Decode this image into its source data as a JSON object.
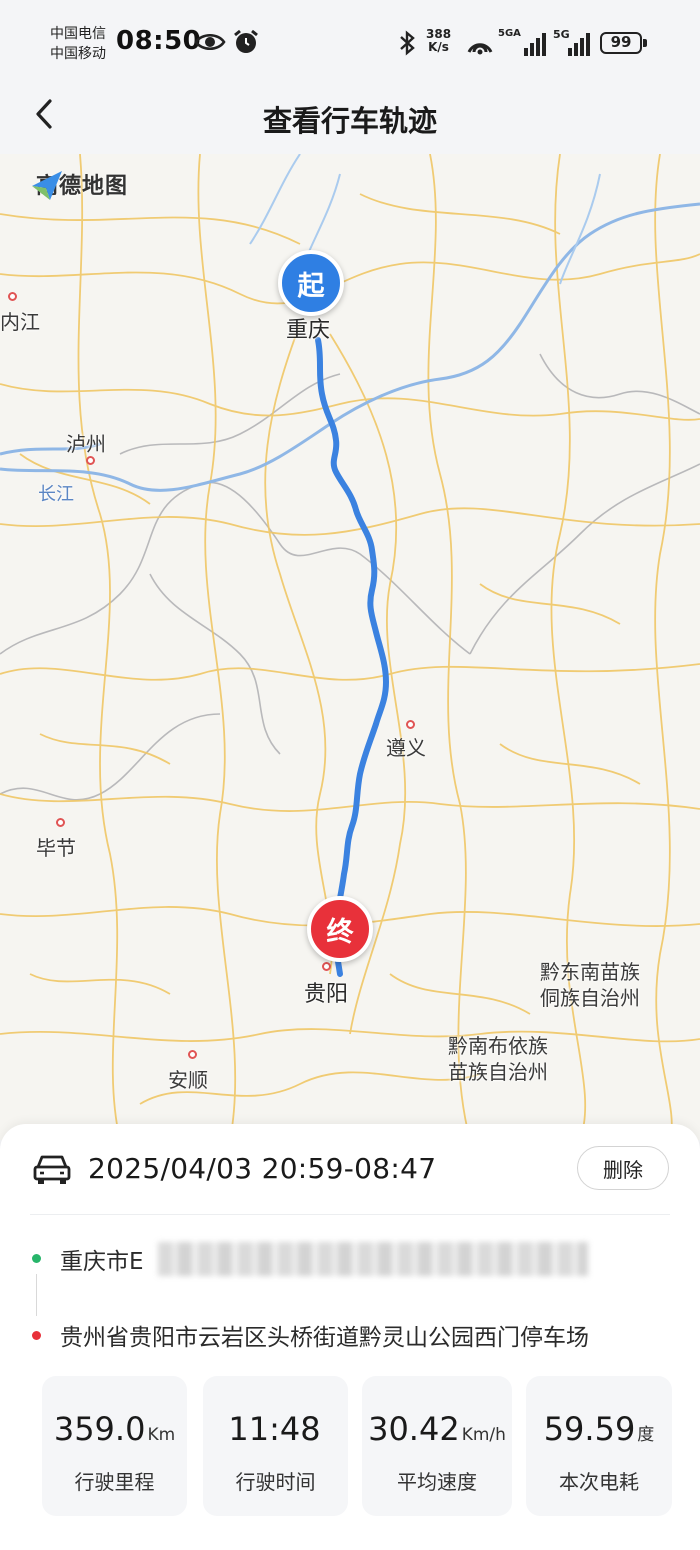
{
  "status_bar": {
    "carrier_1": "中国电信",
    "carrier_2": "中国移动",
    "time": "08:50",
    "net_speed_value": "388",
    "net_speed_unit": "K/s",
    "signal_1": "5GA",
    "signal_2": "5G",
    "battery": "99",
    "icons": [
      "eye-icon",
      "alarm-icon",
      "bluetooth-icon",
      "nfc-icon",
      "signal-icon",
      "signal-icon",
      "battery-icon"
    ]
  },
  "header": {
    "title": "查看行车轨迹",
    "back_icon": "chevron-left-icon"
  },
  "map": {
    "logo_text": "高德地图",
    "start_marker": "起",
    "end_marker": "终",
    "route_color": "#3b82e0",
    "labels": {
      "chongqing": "重庆",
      "neijiang": "内江",
      "luzhou": "泸州",
      "changjiang": "长江",
      "zunyi": "遵义",
      "bijie": "毕节",
      "guiyang": "贵阳",
      "anshun": "安顺",
      "qiandongnan_1": "黔东南苗族",
      "qiandongnan_2": "侗族自治州",
      "qiannan_1": "黔南布依族",
      "qiannan_2": "苗族自治州"
    }
  },
  "trip": {
    "car_icon": "car-icon",
    "time_range": "2025/04/03 20:59-08:47",
    "delete_label": "删除",
    "start_address": "重庆市E",
    "end_address": "贵州省贵阳市云岩区头桥街道黔灵山公园西门停车场"
  },
  "stats": [
    {
      "value": "359.0",
      "unit": "Km",
      "label": "行驶里程"
    },
    {
      "value": "11:48",
      "unit": "",
      "label": "行驶时间"
    },
    {
      "value": "30.42",
      "unit": "Km/h",
      "label": "平均速度"
    },
    {
      "value": "59.59",
      "unit": "度",
      "label": "本次电耗"
    }
  ],
  "colors": {
    "start": "#2f7fe3",
    "end": "#e8313a",
    "start_dot": "#27b56a",
    "end_dot": "#e8313a"
  }
}
